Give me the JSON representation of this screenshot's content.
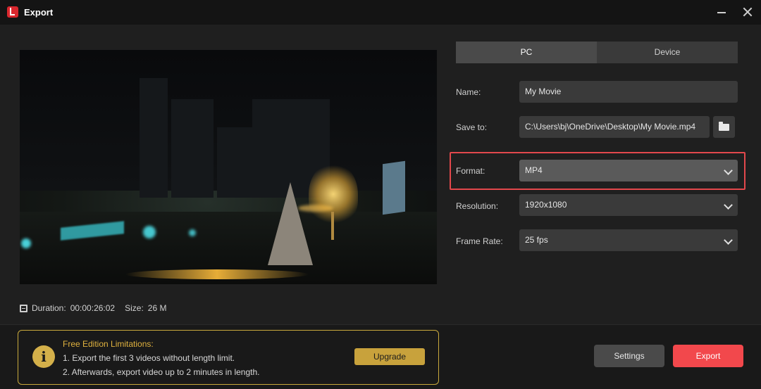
{
  "window": {
    "title": "Export"
  },
  "preview": {
    "duration_label": "Duration:",
    "duration": "00:00:26:02",
    "size_label": "Size:",
    "size": "26 M"
  },
  "tabs": [
    {
      "label": "PC",
      "active": true
    },
    {
      "label": "Device",
      "active": false
    }
  ],
  "form": {
    "name_label": "Name:",
    "name_value": "My Movie",
    "save_label": "Save to:",
    "save_value": "C:\\Users\\bj\\OneDrive\\Desktop\\My Movie.mp4",
    "format_label": "Format:",
    "format_value": "MP4",
    "resolution_label": "Resolution:",
    "resolution_value": "1920x1080",
    "framerate_label": "Frame Rate:",
    "framerate_value": "25 fps"
  },
  "limitations": {
    "title": "Free Edition Limitations:",
    "line1": "1. Export the first 3 videos without length limit.",
    "line2": "2. Afterwards, export video up to 2 minutes in length.",
    "upgrade_label": "Upgrade"
  },
  "actions": {
    "settings_label": "Settings",
    "export_label": "Export"
  },
  "colors": {
    "accent": "#F2484C",
    "highlight": "#E3484C",
    "gold": "#C8A23C"
  },
  "icons": [
    "app-logo-icon",
    "minimize-icon",
    "close-icon",
    "film-icon",
    "folder-icon",
    "chevron-down-icon",
    "info-icon"
  ]
}
